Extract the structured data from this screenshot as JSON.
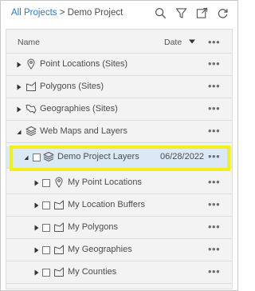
{
  "breadcrumb": {
    "root": "All Projects",
    "separator": " > ",
    "current": "Demo Project"
  },
  "toolbar": {
    "icons": [
      "search-icon",
      "filter-icon",
      "export-icon",
      "refresh-icon"
    ]
  },
  "list": {
    "headers": {
      "name": "Name",
      "date": "Date",
      "more": "•••"
    },
    "rows": [
      {
        "label": "Point Locations (Sites)",
        "icon": "pin-icon",
        "date": "",
        "more": "•••",
        "level": 0,
        "checkbox": false
      },
      {
        "label": "Polygons (Sites)",
        "icon": "polygon-icon",
        "date": "",
        "more": "•••",
        "level": 0,
        "checkbox": false
      },
      {
        "label": "Geographies (Sites)",
        "icon": "geography-icon",
        "date": "",
        "more": "•••",
        "level": 0,
        "checkbox": false
      },
      {
        "label": "Web Maps and Layers",
        "icon": "layers-icon",
        "date": "",
        "more": "•••",
        "level": 0,
        "checkbox": false,
        "expanded": true
      },
      {
        "label": "Demo Project Layers",
        "icon": "layers-icon",
        "date": "06/28/2022",
        "more": "•••",
        "level": 1,
        "checkbox": true,
        "expanded": true,
        "selected": true
      },
      {
        "label": "My Point Locations",
        "icon": "pin-icon",
        "date": "",
        "more": "•••",
        "level": 2,
        "checkbox": true
      },
      {
        "label": "My Location Buffers",
        "icon": "polygon-icon",
        "date": "",
        "more": "•••",
        "level": 2,
        "checkbox": true
      },
      {
        "label": "My Polygons",
        "icon": "polygon-icon",
        "date": "",
        "more": "•••",
        "level": 2,
        "checkbox": true
      },
      {
        "label": "My Geographies",
        "icon": "polygon-icon",
        "date": "",
        "more": "•••",
        "level": 2,
        "checkbox": true
      },
      {
        "label": "My Counties",
        "icon": "polygon-icon",
        "date": "",
        "more": "•••",
        "level": 2,
        "checkbox": true
      }
    ]
  },
  "colors": {
    "link": "#2c7ac9",
    "selected_row": "#dbe9f7",
    "highlight": "#f2ef1c"
  }
}
